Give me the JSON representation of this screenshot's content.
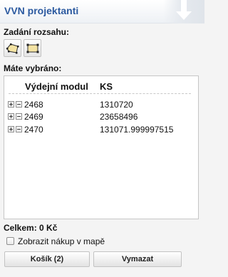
{
  "panel": {
    "title": "VVN projektanti",
    "collapse_icon": "arrow-down-icon"
  },
  "range_section": {
    "label": "Zadání rozsahu:",
    "tools": [
      {
        "name": "polygon-select-icon"
      },
      {
        "name": "rectangle-select-icon"
      }
    ]
  },
  "selection": {
    "label": "Máte vybráno:",
    "columns": [
      "Výdejní modul",
      "KS"
    ],
    "rows": [
      {
        "module": "2468",
        "ks": "1310720"
      },
      {
        "module": "2469",
        "ks": "23658496"
      },
      {
        "module": "2470",
        "ks": "131071.999997515"
      }
    ]
  },
  "summary": {
    "total": "Celkem: 0 Kč"
  },
  "map_option": {
    "label": "Zobrazit nákup v mapě",
    "checked": false
  },
  "actions": {
    "cart_label": "Košík (2)",
    "clear_label": "Vymazat"
  },
  "colors": {
    "title": "#2c5aa0",
    "background": "#f4f4f4"
  }
}
